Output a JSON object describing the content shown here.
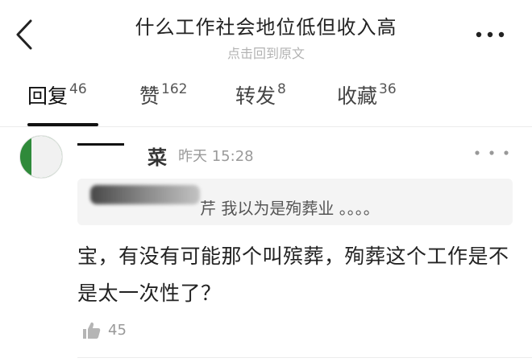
{
  "header": {
    "title": "什么工作社会地位低但收入高",
    "subtitle": "点击回到原文"
  },
  "tabs": [
    {
      "label": "回复",
      "count": "46"
    },
    {
      "label": "赞",
      "count": "162"
    },
    {
      "label": "转发",
      "count": "8"
    },
    {
      "label": "收藏",
      "count": "36"
    }
  ],
  "comment": {
    "author_name": "菜",
    "time": "昨天 15:28",
    "quote_text": "芹 我以为是殉葬业 。。。。",
    "body": "宝，有没有可能那个叫殡葬，殉葬这个工作是不是太一次性了？",
    "like_count": "45"
  },
  "colors": {
    "active_indicator": "#111111",
    "muted_text": "#999999",
    "quote_background": "#f4f4f4"
  },
  "icons": [
    "back-arrow-icon",
    "more-dots-icon",
    "thumbs-up-icon"
  ]
}
